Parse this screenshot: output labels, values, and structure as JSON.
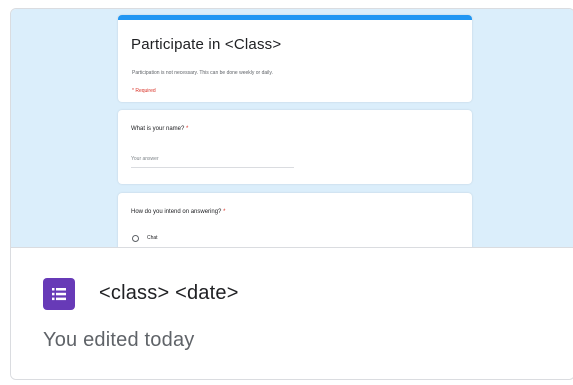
{
  "thumbnail": {
    "accent_color": "#2196f3",
    "background_color": "#dbeefb",
    "form": {
      "title": "Participate in <Class>",
      "description": "Participation is not necessary. This can be done weekly or daily.",
      "required_note": "* Required"
    },
    "questions": [
      {
        "label": "What is your name?",
        "required_mark": "*",
        "placeholder": "Your answer"
      },
      {
        "label": "How do you intend on answering?",
        "required_mark": "*",
        "option": "Chat"
      }
    ]
  },
  "card": {
    "icon": "google-forms-icon",
    "icon_color": "#673ab7",
    "name": "<class> <date>",
    "status": "You edited today"
  }
}
